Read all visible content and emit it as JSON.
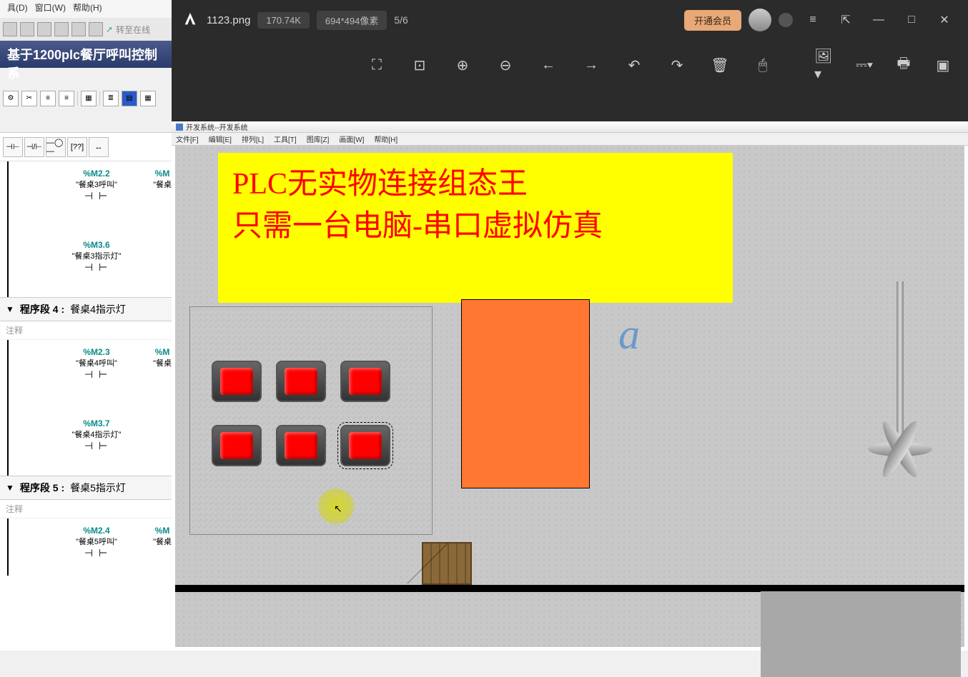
{
  "bg_app": {
    "menu": [
      "具(D)",
      "窗口(W)",
      "帮助(H)"
    ],
    "go_online": "转至在线",
    "title": "基于1200plc餐厅呼叫控制系",
    "ladder_toolbar": [
      "⊣⊢",
      "⊣/⊢",
      "—◯—",
      "[??]",
      "↔"
    ],
    "rungs": [
      {
        "tag": "%M2.2",
        "label": "\"餐桌3呼叫\"",
        "partial_tag": "%M",
        "partial_label": "\"餐桌"
      },
      {
        "tag": "%M3.6",
        "label": "\"餐桌3指示灯\""
      }
    ],
    "segment4": {
      "title": "程序段 4 :",
      "desc": "餐桌4指示灯",
      "comment": "注释"
    },
    "rungs4": [
      {
        "tag": "%M2.3",
        "label": "\"餐桌4呼叫\"",
        "partial_tag": "%M",
        "partial_label": "\"餐桌"
      },
      {
        "tag": "%M3.7",
        "label": "\"餐桌4指示灯\""
      }
    ],
    "segment5": {
      "title": "程序段 5 :",
      "desc": "餐桌5指示灯",
      "comment": "注释"
    },
    "rungs5": [
      {
        "tag": "%M2.4",
        "label": "\"餐桌5呼叫\"",
        "partial_tag": "%M",
        "partial_label": "\"餐桌"
      }
    ]
  },
  "viewer": {
    "filename": "1123.png",
    "filesize": "170.74K",
    "dimensions": "694*494像素",
    "counter": "5/6",
    "vip_label": "开通会员"
  },
  "inner_app": {
    "title": "开发系统--开发系统",
    "menu": [
      "文件[F]",
      "编辑[E]",
      "排列[L]",
      "工具[T]",
      "图库[Z]",
      "画面[W]",
      "帮助[H]"
    ]
  },
  "banner": {
    "line1": "PLC无实物连接组态王",
    "line2": "只需一台电脑-串口虚拟仿真"
  },
  "canvas": {
    "letter": "a"
  }
}
